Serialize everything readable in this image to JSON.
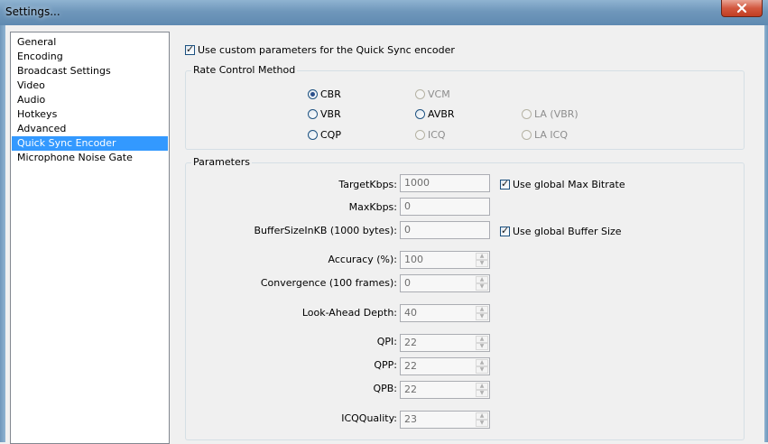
{
  "window": {
    "title": "Settings..."
  },
  "sidebar": {
    "items": [
      {
        "label": "General"
      },
      {
        "label": "Encoding"
      },
      {
        "label": "Broadcast Settings"
      },
      {
        "label": "Video"
      },
      {
        "label": "Audio"
      },
      {
        "label": "Hotkeys"
      },
      {
        "label": "Advanced"
      },
      {
        "label": "Quick Sync Encoder",
        "selected": true
      },
      {
        "label": "Microphone Noise Gate"
      }
    ]
  },
  "custom_params": {
    "label": "Use custom parameters for the Quick Sync encoder",
    "checked": true
  },
  "rate_control": {
    "title": "Rate Control Method",
    "options": [
      {
        "label": "CBR",
        "selected": true,
        "enabled": true
      },
      {
        "label": "VCM",
        "selected": false,
        "enabled": false
      },
      {
        "label": "VBR",
        "selected": false,
        "enabled": true
      },
      {
        "label": "AVBR",
        "selected": false,
        "enabled": true
      },
      {
        "label": "LA (VBR)",
        "selected": false,
        "enabled": false
      },
      {
        "label": "CQP",
        "selected": false,
        "enabled": true
      },
      {
        "label": "ICQ",
        "selected": false,
        "enabled": false
      },
      {
        "label": "LA ICQ",
        "selected": false,
        "enabled": false
      }
    ]
  },
  "parameters": {
    "title": "Parameters",
    "target_kbps": {
      "label": "TargetKbps:",
      "value": "1000"
    },
    "max_kbps": {
      "label": "MaxKbps:",
      "value": "0"
    },
    "buffer_size": {
      "label": "BufferSizeInKB (1000 bytes):",
      "value": "0"
    },
    "global_max_bitrate": {
      "label": "Use global Max Bitrate",
      "checked": true
    },
    "global_buffer_size": {
      "label": "Use global Buffer Size",
      "checked": true
    },
    "accuracy": {
      "label": "Accuracy (%):",
      "value": "100"
    },
    "convergence": {
      "label": "Convergence (100 frames):",
      "value": "0"
    },
    "lookahead": {
      "label": "Look-Ahead Depth:",
      "value": "40"
    },
    "qpi": {
      "label": "QPI:",
      "value": "22"
    },
    "qpp": {
      "label": "QPP:",
      "value": "22"
    },
    "qpb": {
      "label": "QPB:",
      "value": "22"
    },
    "icq_quality": {
      "label": "ICQQuality:",
      "value": "23"
    }
  },
  "colors": {
    "selection": "#3399ff",
    "titlebar": "#6f97bb",
    "close": "#c23d22"
  }
}
